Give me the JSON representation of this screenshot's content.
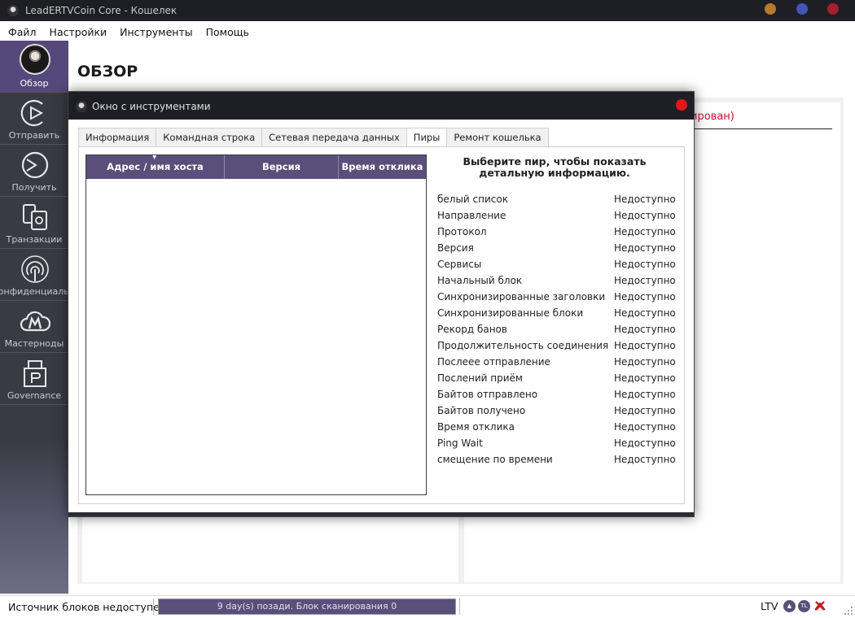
{
  "window": {
    "title": "LeadERTVCoin Core - Кошелек",
    "dots": [
      "#b57a2e",
      "#4156b5",
      "#a3202c"
    ]
  },
  "menu": [
    "Файл",
    "Настройки",
    "Инструменты",
    "Помощь"
  ],
  "sidebar": {
    "items": [
      {
        "label": "Обзор",
        "icon": "avatar-icon"
      },
      {
        "label": "Отправить",
        "icon": "send-icon"
      },
      {
        "label": "Получить",
        "icon": "receive-icon"
      },
      {
        "label": "Транзакции",
        "icon": "transactions-icon"
      },
      {
        "label": "Конфиденциальность",
        "icon": "privacy-icon"
      },
      {
        "label": "Мастерноды",
        "icon": "masternodes-icon"
      },
      {
        "label": "Governance",
        "icon": "governance-icon"
      }
    ]
  },
  "main": {
    "title": "ОБЗОР",
    "red_text": "ирован)"
  },
  "status": {
    "source": "Источник блоков недоступен",
    "progress_text": "9 day(s) позади. Блок сканирования 0",
    "progress_fraction": 1.0,
    "unit": "LTV",
    "icons": [
      "chevron-up-icon",
      "tl-icon",
      "network-disabled-icon"
    ],
    "icon_text_tl": "TL"
  },
  "dialog": {
    "title": "Окно с инструментами",
    "tabs": [
      "Информация",
      "Командная строка",
      "Сетевая передача данных",
      "Пиры",
      "Ремонт кошелька"
    ],
    "active_tab": 3,
    "table_headers": [
      "Адрес / имя хоста",
      "Версия",
      "Время отклика"
    ],
    "sort_arrow": "▼",
    "detail_title": "Выберите пир, чтобы показать детальную информацию.",
    "details": [
      {
        "key": "белый список",
        "value": "Недоступно"
      },
      {
        "key": "Направление",
        "value": "Недоступно"
      },
      {
        "key": "Протокол",
        "value": "Недоступно"
      },
      {
        "key": "Версия",
        "value": "Недоступно"
      },
      {
        "key": "Сервисы",
        "value": "Недоступно"
      },
      {
        "key": "Начальный блок",
        "value": "Недоступно"
      },
      {
        "key": "Синхронизированные заголовки",
        "value": "Недоступно"
      },
      {
        "key": "Синхронизированные блоки",
        "value": "Недоступно"
      },
      {
        "key": "Рекорд банов",
        "value": "Недоступно"
      },
      {
        "key": "Продолжительность соединения",
        "value": "Недоступно"
      },
      {
        "key": "Послеее отправление",
        "value": "Недоступно"
      },
      {
        "key": "Послений приём",
        "value": "Недоступно"
      },
      {
        "key": "Байтов отправлено",
        "value": "Недоступно"
      },
      {
        "key": "Байтов получено",
        "value": "Недоступно"
      },
      {
        "key": "Время отклика",
        "value": "Недоступно"
      },
      {
        "key": "Ping Wait",
        "value": "Недоступно"
      },
      {
        "key": "смещение по времени",
        "value": "Недоступно"
      }
    ]
  }
}
